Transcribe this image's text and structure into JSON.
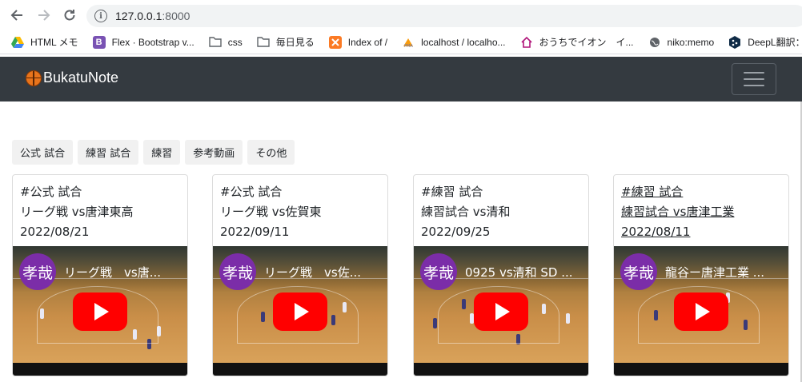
{
  "browser": {
    "url_host": "127.0.0.1",
    "url_port": ":8000",
    "bookmarks": [
      {
        "label": "HTML メモ",
        "icon": "google-drive-icon"
      },
      {
        "label": "Flex · Bootstrap v...",
        "icon": "bootstrap-icon"
      },
      {
        "label": "css",
        "icon": "folder-icon"
      },
      {
        "label": "毎日見る",
        "icon": "folder-icon"
      },
      {
        "label": "Index of /",
        "icon": "xampp-icon"
      },
      {
        "label": "localhost / localho...",
        "icon": "phpmyadmin-icon"
      },
      {
        "label": "おうちでイオン　イ...",
        "icon": "house-icon"
      },
      {
        "label": "niko:memo",
        "icon": "globe-icon"
      },
      {
        "label": "DeepL翻訳：",
        "icon": "deepl-icon"
      }
    ]
  },
  "navbar": {
    "brand": "BukatuNote"
  },
  "filters": [
    "公式 試合",
    "練習 試合",
    "練習",
    "参考動画",
    "その他"
  ],
  "cards": [
    {
      "tag": "#公式 試合",
      "title": "リーグ戦 vs唐津東高",
      "date": "2022/08/21",
      "video_title": "リーグ戦　vs唐...",
      "channel_avatar": "孝哉"
    },
    {
      "tag": "#公式 試合",
      "title": "リーグ戦 vs佐賀東",
      "date": "2022/09/11",
      "video_title": "リーグ戦　vs佐...",
      "channel_avatar": "孝哉"
    },
    {
      "tag": "#練習 試合",
      "title": "練習試合 vs清和",
      "date": "2022/09/25",
      "video_title": "0925 vs清和 SD ...",
      "channel_avatar": "孝哉"
    },
    {
      "tag": "#練習 試合",
      "title": "練習試合 vs唐津工業",
      "date": "2022/08/11",
      "video_title": "龍谷ー唐津工業 ...",
      "channel_avatar": "孝哉"
    }
  ],
  "colors": {
    "navbar_bg": "#343a40",
    "avatar_bg": "#7b2da8",
    "play_red": "#ff0000"
  }
}
